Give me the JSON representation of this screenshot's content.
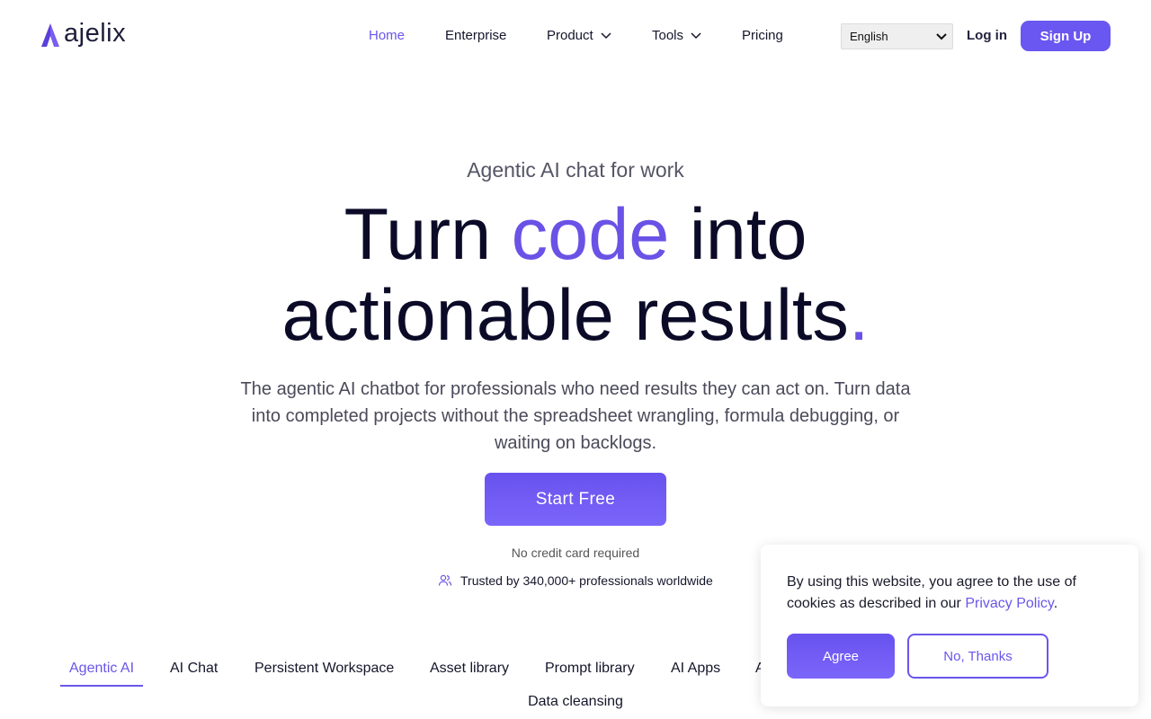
{
  "brand": {
    "name": "ajelix",
    "accent_color": "#6a56ea"
  },
  "nav": {
    "items": [
      {
        "label": "Home",
        "active": true,
        "has_dropdown": false
      },
      {
        "label": "Enterprise",
        "active": false,
        "has_dropdown": false
      },
      {
        "label": "Product",
        "active": false,
        "has_dropdown": true
      },
      {
        "label": "Tools",
        "active": false,
        "has_dropdown": true
      },
      {
        "label": "Pricing",
        "active": false,
        "has_dropdown": false
      }
    ],
    "language": "English",
    "login_label": "Log in",
    "signup_label": "Sign Up"
  },
  "hero": {
    "eyebrow": "Agentic AI chat for work",
    "headline_part1": "Turn ",
    "headline_accent": "code",
    "headline_part2": " into",
    "headline_line2": "actionable results",
    "headline_dot": ".",
    "subtext": "The agentic AI chatbot for professionals who need results they can act on. Turn data into completed projects without the spreadsheet wrangling, formula debugging, or waiting on backlogs.",
    "cta_label": "Start Free",
    "no_card": "No credit card required",
    "trusted": "Trusted by 340,000+ professionals worldwide"
  },
  "tabs": {
    "items": [
      "Agentic AI",
      "AI Chat",
      "Persistent Workspace",
      "Asset library",
      "Prompt library",
      "AI Apps",
      "A"
    ],
    "active": "Agentic AI",
    "row2": "Data cleansing"
  },
  "cookie": {
    "text_before": "By using this website, you agree to the use of cookies as described in our ",
    "link": "Privacy Policy",
    "text_after": ".",
    "agree_label": "Agree",
    "decline_label": "No, Thanks"
  }
}
